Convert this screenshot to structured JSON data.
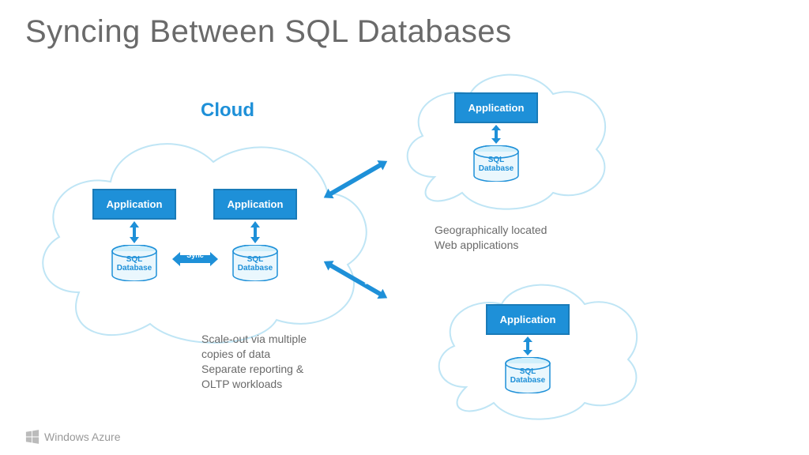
{
  "title": "Syncing Between SQL Databases",
  "cloud_label": "Cloud",
  "main_cloud": {
    "app1": "Application",
    "app2": "Application",
    "db1_line1": "SQL",
    "db1_line2": "Database",
    "db2_line1": "SQL",
    "db2_line2": "Database"
  },
  "top_cloud": {
    "app": "Application",
    "db_line1": "SQL",
    "db_line2": "Database"
  },
  "bottom_cloud": {
    "app": "Application",
    "db_line1": "SQL",
    "db_line2": "Database"
  },
  "sync_label": "Sync",
  "side_text_top_line1": "Geographically located",
  "side_text_top_line2": "Web applications",
  "side_text_bottom_line1": "Scale-out via multiple",
  "side_text_bottom_line2": "copies of data",
  "side_text_bottom_line3": "Separate reporting &",
  "side_text_bottom_line4": "OLTP workloads",
  "footer_brand": "Windows Azure",
  "colors": {
    "accent": "#1e90d8",
    "cloud_stroke": "#bfe5f5",
    "text_gray": "#6a6a6a"
  }
}
